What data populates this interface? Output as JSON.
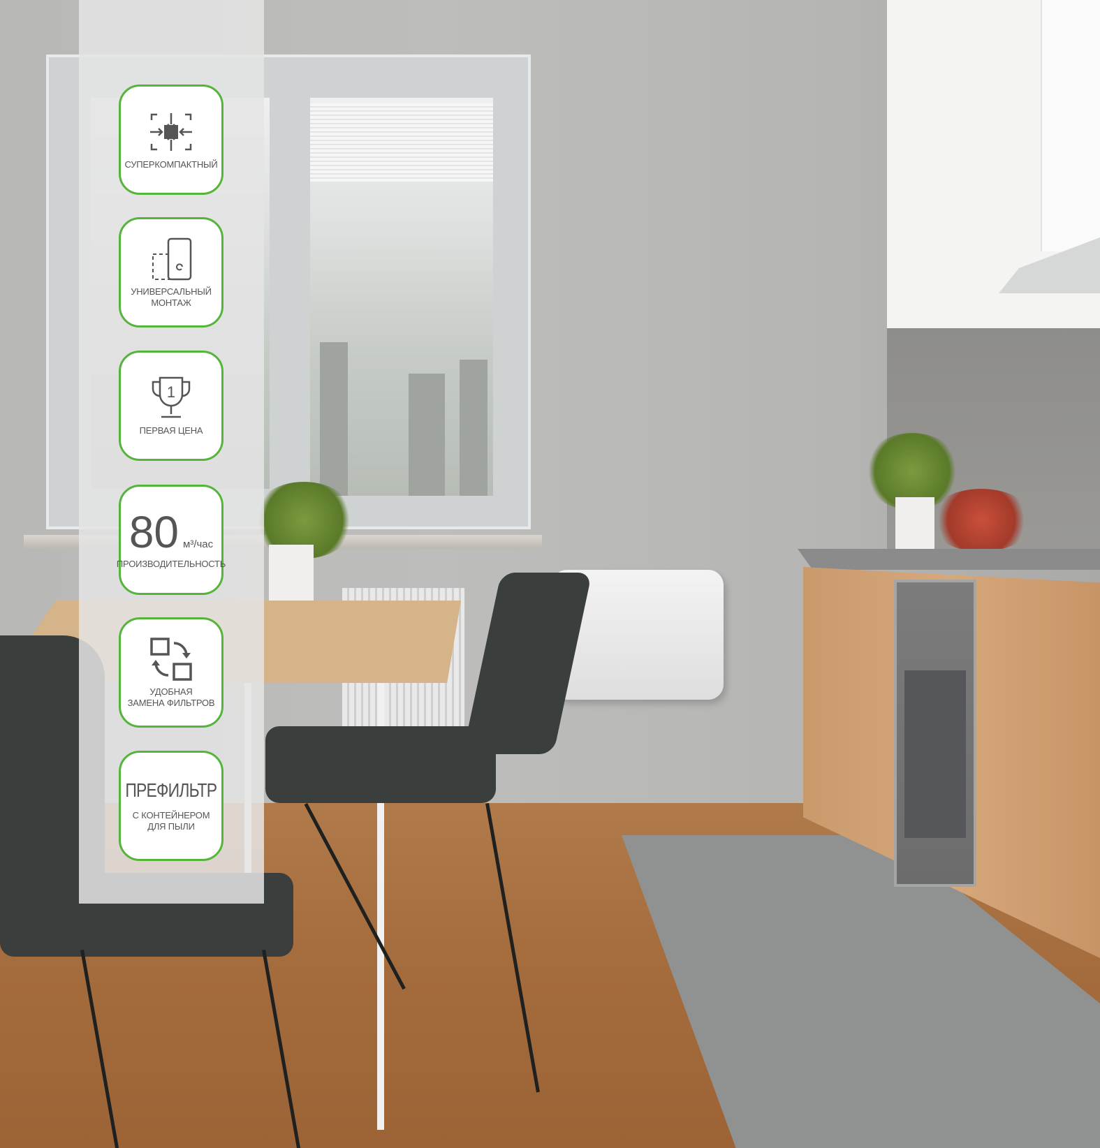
{
  "features": [
    {
      "icon": "compact-arrows-icon",
      "label": "СУПЕРКОМПАКТНЫЙ"
    },
    {
      "icon": "universal-mount-icon",
      "label": "УНИВЕРСАЛЬНЫЙ\nМОНТАЖ"
    },
    {
      "icon": "trophy-first-icon",
      "label": "ПЕРВАЯ ЦЕНА",
      "trophy_number": "1"
    },
    {
      "value": "80",
      "unit": "м³/час",
      "label": "ПРОИЗВОДИТЕЛЬНОСТЬ"
    },
    {
      "icon": "filter-swap-icon",
      "label": "УДОБНАЯ\nЗАМЕНА ФИЛЬТРОВ"
    },
    {
      "title": "ПРЕФИЛЬТР",
      "label": "С КОНТЕЙНЕРОМ\nДЛЯ ПЫЛИ"
    }
  ],
  "colors": {
    "badge_border": "#55b43b",
    "badge_text": "#555555",
    "panel_bg": "#e4e4e4"
  }
}
